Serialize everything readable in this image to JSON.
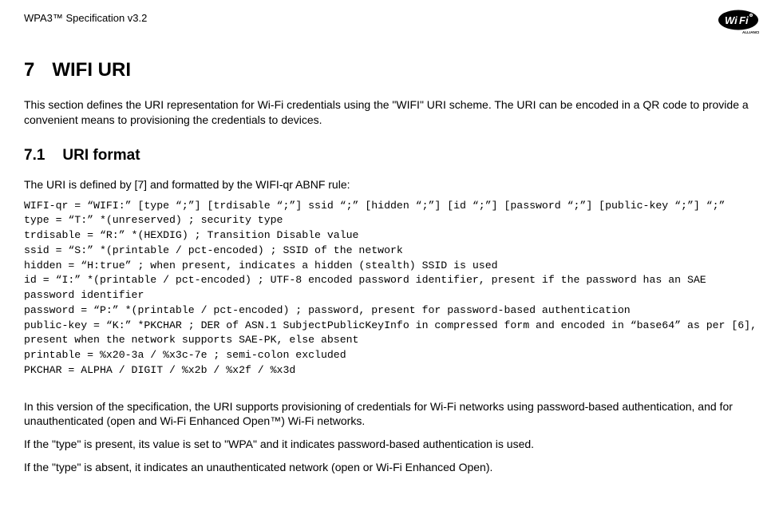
{
  "header": {
    "doc_title": "WPA3™ Specification v3.2",
    "logo_label": "WiFi ALLIANCE"
  },
  "section7": {
    "number": "7",
    "title": "WIFI URI",
    "intro": "This section defines the URI representation for Wi-Fi credentials using the \"WIFI\" URI scheme. The URI can be encoded in a QR code to provide a convenient means to provisioning the credentials to devices."
  },
  "section7_1": {
    "number": "7.1",
    "title": "URI format",
    "lead": "The URI is defined by [7] and formatted by the WIFI-qr ABNF rule:",
    "abnf": "WIFI-qr = “WIFI:” [type “;”] [trdisable “;”] ssid “;” [hidden “;”] [id “;”] [password “;”] [public-key “;”] “;”\ntype = “T:” *(unreserved) ; security type\ntrdisable = “R:” *(HEXDIG) ; Transition Disable value\nssid = “S:” *(printable / pct-encoded) ; SSID of the network\nhidden = “H:true” ; when present, indicates a hidden (stealth) SSID is used\nid = “I:” *(printable / pct-encoded) ; UTF-8 encoded password identifier, present if the password has an SAE password identifier\npassword = “P:” *(printable / pct-encoded) ; password, present for password-based authentication\npublic-key = “K:” *PKCHAR ; DER of ASN.1 SubjectPublicKeyInfo in compressed form and encoded in “base64” as per [6], present when the network supports SAE-PK, else absent\nprintable = %x20-3a / %x3c-7e ; semi-colon excluded\nPKCHAR = ALPHA / DIGIT / %x2b / %x2f / %x3d",
    "p1": "In this version of the specification, the URI supports provisioning of credentials for Wi-Fi networks using password-based authentication, and for unauthenticated (open and Wi-Fi Enhanced Open™) Wi-Fi networks.",
    "p2": "If the \"type\" is present, its value is set to \"WPA\" and it indicates password-based authentication is used.",
    "p3": "If the \"type\" is absent, it indicates an unauthenticated network (open or Wi-Fi Enhanced Open)."
  }
}
